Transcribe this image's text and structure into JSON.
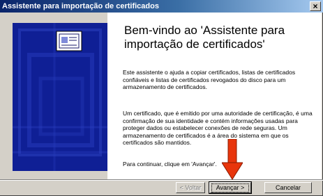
{
  "window": {
    "title": "Assistente para importação de certificados",
    "close_glyph": "×"
  },
  "content": {
    "heading": "Bem-vindo ao 'Assistente para importação de certificados'",
    "paragraph1": "Este assistente o ajuda a copiar certificados, listas de certificados confiáveis e listas de certificados revogados do disco para um armazenamento de certificados.",
    "paragraph2": "Um certificado, que é emitido por uma autoridade de certificação, é uma confirmação de sua identidade e contém informações usadas para proteger dados ou estabelecer conexões de rede seguras. Um armazenamento de certificados é a área do sistema em que os certificados são mantidos.",
    "paragraph3": "Para continuar, clique em 'Avançar'."
  },
  "buttons": {
    "back": "< Voltar",
    "next": "Avançar >",
    "cancel": "Cancelar"
  },
  "colors": {
    "banner": "#0f1f95",
    "title_gradient_start": "#0a246a",
    "arrow": "#e8350c"
  },
  "icons": [
    "certificate-icon",
    "close-icon",
    "arrow-annotation-icon"
  ]
}
